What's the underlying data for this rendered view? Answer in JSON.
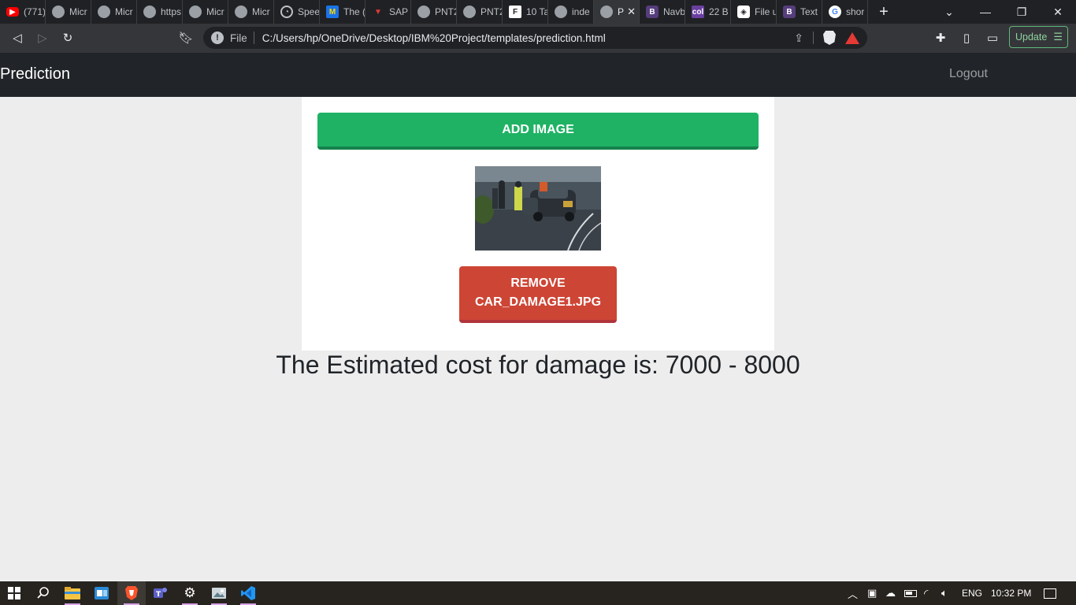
{
  "browser": {
    "tabs": [
      {
        "label": "(771)",
        "icon": "youtube-icon",
        "cls": "fi-yt",
        "glyph": "▶"
      },
      {
        "label": "Micr",
        "icon": "globe-icon",
        "cls": "fi-globe",
        "glyph": ""
      },
      {
        "label": "Micr",
        "icon": "globe-icon",
        "cls": "fi-globe",
        "glyph": ""
      },
      {
        "label": "https",
        "icon": "globe-icon",
        "cls": "fi-globe",
        "glyph": ""
      },
      {
        "label": "Micr",
        "icon": "globe-icon",
        "cls": "fi-globe",
        "glyph": ""
      },
      {
        "label": "Micr",
        "icon": "globe-icon",
        "cls": "fi-globe",
        "glyph": ""
      },
      {
        "label": "Spee",
        "icon": "speedometer-icon",
        "cls": "fi-speed",
        "glyph": "◔"
      },
      {
        "label": "The (",
        "icon": "the-site-icon",
        "cls": "fi-the",
        "glyph": "M"
      },
      {
        "label": "SAP",
        "icon": "sap-icon",
        "cls": "fi-sap",
        "glyph": "▼"
      },
      {
        "label": "PNT2",
        "icon": "globe-icon",
        "cls": "fi-globe",
        "glyph": ""
      },
      {
        "label": "PNT2",
        "icon": "globe-icon",
        "cls": "fi-globe",
        "glyph": ""
      },
      {
        "label": "10 Ta",
        "icon": "f-site-icon",
        "cls": "fi-f",
        "glyph": "F"
      },
      {
        "label": "inde",
        "icon": "globe-icon",
        "cls": "fi-globe",
        "glyph": ""
      },
      {
        "label": "P",
        "icon": "globe-icon",
        "cls": "fi-globe",
        "glyph": "",
        "active": true
      },
      {
        "label": "Navb",
        "icon": "bootstrap-icon",
        "cls": "fi-b",
        "glyph": "B"
      },
      {
        "label": "22 B",
        "icon": "colorlib-icon",
        "cls": "fi-col",
        "glyph": "col"
      },
      {
        "label": "File u",
        "icon": "codepen-icon",
        "cls": "fi-file",
        "glyph": "◈"
      },
      {
        "label": "Text",
        "icon": "bootstrap-icon",
        "cls": "fi-b",
        "glyph": "B"
      },
      {
        "label": "shor",
        "icon": "google-icon",
        "cls": "fi-g",
        "glyph": "G"
      }
    ],
    "address": {
      "scheme_label": "File",
      "url": "C:/Users/hp/OneDrive/Desktop/IBM%20Project/templates/prediction.html"
    },
    "update_label": "Update"
  },
  "app": {
    "brand": "Prediction",
    "logout": "Logout",
    "add_image": "ADD IMAGE",
    "remove_line1": "REMOVE",
    "remove_line2": "CAR_DAMAGE1.JPG",
    "result": "The Estimated cost for damage is: 7000 - 8000"
  },
  "taskbar": {
    "language": "ENG",
    "time": "10:32 PM"
  },
  "colors": {
    "add_button": "#1fb264",
    "remove_button": "#cd4535",
    "navbar": "#212529",
    "page_bg": "#ededed"
  }
}
